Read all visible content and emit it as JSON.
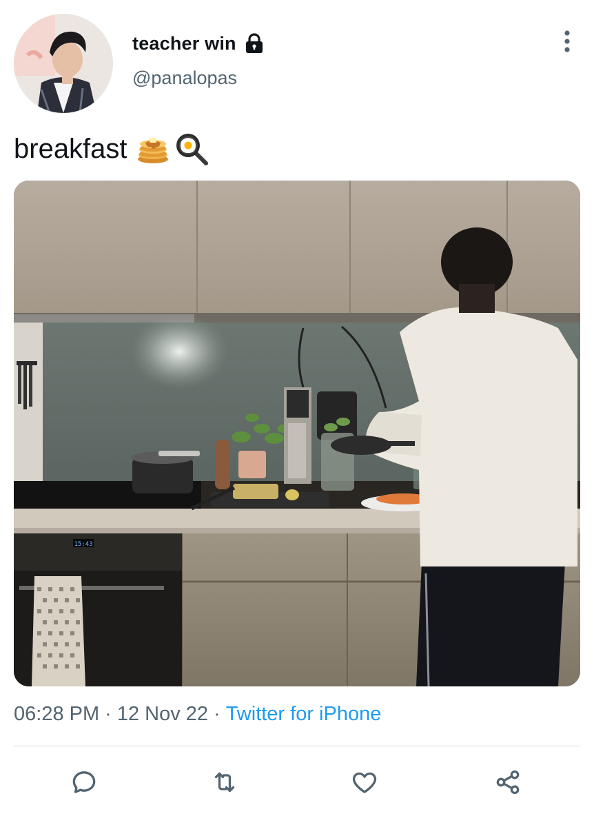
{
  "author": {
    "display_name": "teacher win",
    "handle": "@panalopas",
    "protected_icon": "lock-icon",
    "avatar": "profile-photo"
  },
  "tweet": {
    "text": "breakfast",
    "emojis": [
      "pancakes-emoji",
      "frying-pan-egg-emoji"
    ],
    "media": "kitchen-photo"
  },
  "meta": {
    "time": "06:28 PM",
    "separator": "·",
    "date": "12 Nov 22",
    "source": "Twitter for iPhone"
  },
  "actions": [
    {
      "icon": "reply-icon"
    },
    {
      "icon": "retweet-icon"
    },
    {
      "icon": "like-icon"
    },
    {
      "icon": "share-icon"
    }
  ],
  "menu_icon": "more-options-icon",
  "colors": {
    "text_primary": "#0f1419",
    "text_secondary": "#536471",
    "link": "#1d9bf0",
    "divider": "#cfd9de"
  },
  "photo_text": {
    "oven_display": "15:43"
  }
}
